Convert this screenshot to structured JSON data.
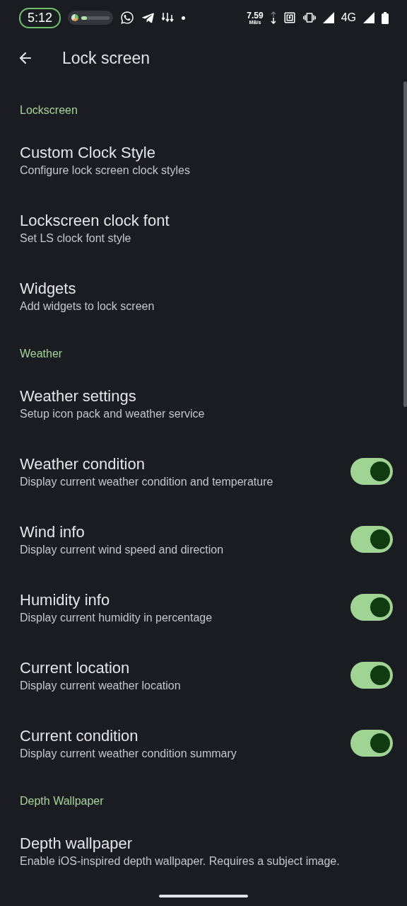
{
  "status_bar": {
    "time": "5:12",
    "media": {
      "level": 0.2
    },
    "speed_value": "7.59",
    "speed_unit": "MB/s",
    "network": "4G"
  },
  "toolbar": {
    "title": "Lock screen"
  },
  "sections": [
    {
      "header": "Lockscreen",
      "items": [
        {
          "title": "Custom Clock Style",
          "subtitle": "Configure lock screen clock styles",
          "kind": "link"
        },
        {
          "title": "Lockscreen clock font",
          "subtitle": "Set LS clock font style",
          "kind": "link"
        },
        {
          "title": "Widgets",
          "subtitle": "Add widgets to lock screen",
          "kind": "link"
        }
      ]
    },
    {
      "header": "Weather",
      "items": [
        {
          "title": "Weather settings",
          "subtitle": "Setup icon pack and weather service",
          "kind": "link"
        },
        {
          "title": "Weather condition",
          "subtitle": "Display current weather condition and temperature",
          "kind": "switch",
          "on": true
        },
        {
          "title": "Wind info",
          "subtitle": "Display current wind speed and direction",
          "kind": "switch",
          "on": true
        },
        {
          "title": "Humidity info",
          "subtitle": "Display current humidity in percentage",
          "kind": "switch",
          "on": true
        },
        {
          "title": "Current location",
          "subtitle": "Display current weather location",
          "kind": "switch",
          "on": true
        },
        {
          "title": "Current condition",
          "subtitle": "Display current weather condition summary",
          "kind": "switch",
          "on": true
        }
      ]
    },
    {
      "header": "Depth Wallpaper",
      "items": [
        {
          "title": "Depth wallpaper",
          "subtitle": "Enable iOS-inspired depth wallpaper. Requires a subject image.",
          "kind": "link"
        }
      ]
    }
  ]
}
